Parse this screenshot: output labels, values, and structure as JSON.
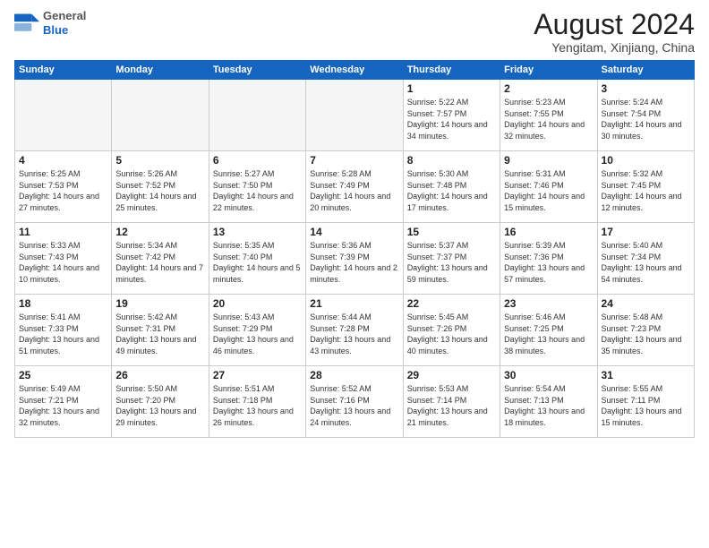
{
  "header": {
    "logo_general": "General",
    "logo_blue": "Blue",
    "month_title": "August 2024",
    "location": "Yengitam, Xinjiang, China"
  },
  "days_of_week": [
    "Sunday",
    "Monday",
    "Tuesday",
    "Wednesday",
    "Thursday",
    "Friday",
    "Saturday"
  ],
  "weeks": [
    [
      {
        "day": "",
        "info": ""
      },
      {
        "day": "",
        "info": ""
      },
      {
        "day": "",
        "info": ""
      },
      {
        "day": "",
        "info": ""
      },
      {
        "day": "1",
        "info": "Sunrise: 5:22 AM\nSunset: 7:57 PM\nDaylight: 14 hours\nand 34 minutes."
      },
      {
        "day": "2",
        "info": "Sunrise: 5:23 AM\nSunset: 7:55 PM\nDaylight: 14 hours\nand 32 minutes."
      },
      {
        "day": "3",
        "info": "Sunrise: 5:24 AM\nSunset: 7:54 PM\nDaylight: 14 hours\nand 30 minutes."
      }
    ],
    [
      {
        "day": "4",
        "info": "Sunrise: 5:25 AM\nSunset: 7:53 PM\nDaylight: 14 hours\nand 27 minutes."
      },
      {
        "day": "5",
        "info": "Sunrise: 5:26 AM\nSunset: 7:52 PM\nDaylight: 14 hours\nand 25 minutes."
      },
      {
        "day": "6",
        "info": "Sunrise: 5:27 AM\nSunset: 7:50 PM\nDaylight: 14 hours\nand 22 minutes."
      },
      {
        "day": "7",
        "info": "Sunrise: 5:28 AM\nSunset: 7:49 PM\nDaylight: 14 hours\nand 20 minutes."
      },
      {
        "day": "8",
        "info": "Sunrise: 5:30 AM\nSunset: 7:48 PM\nDaylight: 14 hours\nand 17 minutes."
      },
      {
        "day": "9",
        "info": "Sunrise: 5:31 AM\nSunset: 7:46 PM\nDaylight: 14 hours\nand 15 minutes."
      },
      {
        "day": "10",
        "info": "Sunrise: 5:32 AM\nSunset: 7:45 PM\nDaylight: 14 hours\nand 12 minutes."
      }
    ],
    [
      {
        "day": "11",
        "info": "Sunrise: 5:33 AM\nSunset: 7:43 PM\nDaylight: 14 hours\nand 10 minutes."
      },
      {
        "day": "12",
        "info": "Sunrise: 5:34 AM\nSunset: 7:42 PM\nDaylight: 14 hours\nand 7 minutes."
      },
      {
        "day": "13",
        "info": "Sunrise: 5:35 AM\nSunset: 7:40 PM\nDaylight: 14 hours\nand 5 minutes."
      },
      {
        "day": "14",
        "info": "Sunrise: 5:36 AM\nSunset: 7:39 PM\nDaylight: 14 hours\nand 2 minutes."
      },
      {
        "day": "15",
        "info": "Sunrise: 5:37 AM\nSunset: 7:37 PM\nDaylight: 13 hours\nand 59 minutes."
      },
      {
        "day": "16",
        "info": "Sunrise: 5:39 AM\nSunset: 7:36 PM\nDaylight: 13 hours\nand 57 minutes."
      },
      {
        "day": "17",
        "info": "Sunrise: 5:40 AM\nSunset: 7:34 PM\nDaylight: 13 hours\nand 54 minutes."
      }
    ],
    [
      {
        "day": "18",
        "info": "Sunrise: 5:41 AM\nSunset: 7:33 PM\nDaylight: 13 hours\nand 51 minutes."
      },
      {
        "day": "19",
        "info": "Sunrise: 5:42 AM\nSunset: 7:31 PM\nDaylight: 13 hours\nand 49 minutes."
      },
      {
        "day": "20",
        "info": "Sunrise: 5:43 AM\nSunset: 7:29 PM\nDaylight: 13 hours\nand 46 minutes."
      },
      {
        "day": "21",
        "info": "Sunrise: 5:44 AM\nSunset: 7:28 PM\nDaylight: 13 hours\nand 43 minutes."
      },
      {
        "day": "22",
        "info": "Sunrise: 5:45 AM\nSunset: 7:26 PM\nDaylight: 13 hours\nand 40 minutes."
      },
      {
        "day": "23",
        "info": "Sunrise: 5:46 AM\nSunset: 7:25 PM\nDaylight: 13 hours\nand 38 minutes."
      },
      {
        "day": "24",
        "info": "Sunrise: 5:48 AM\nSunset: 7:23 PM\nDaylight: 13 hours\nand 35 minutes."
      }
    ],
    [
      {
        "day": "25",
        "info": "Sunrise: 5:49 AM\nSunset: 7:21 PM\nDaylight: 13 hours\nand 32 minutes."
      },
      {
        "day": "26",
        "info": "Sunrise: 5:50 AM\nSunset: 7:20 PM\nDaylight: 13 hours\nand 29 minutes."
      },
      {
        "day": "27",
        "info": "Sunrise: 5:51 AM\nSunset: 7:18 PM\nDaylight: 13 hours\nand 26 minutes."
      },
      {
        "day": "28",
        "info": "Sunrise: 5:52 AM\nSunset: 7:16 PM\nDaylight: 13 hours\nand 24 minutes."
      },
      {
        "day": "29",
        "info": "Sunrise: 5:53 AM\nSunset: 7:14 PM\nDaylight: 13 hours\nand 21 minutes."
      },
      {
        "day": "30",
        "info": "Sunrise: 5:54 AM\nSunset: 7:13 PM\nDaylight: 13 hours\nand 18 minutes."
      },
      {
        "day": "31",
        "info": "Sunrise: 5:55 AM\nSunset: 7:11 PM\nDaylight: 13 hours\nand 15 minutes."
      }
    ]
  ]
}
